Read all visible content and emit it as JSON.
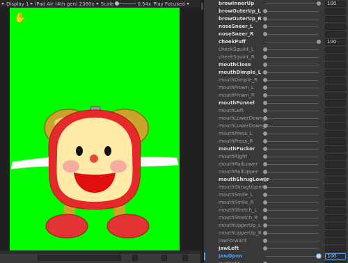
{
  "toolbar": {
    "display": "Display 1",
    "device": "iPad Air (4th gen)",
    "resolution": "2360x",
    "scale_label": "Scale",
    "scale_value": "0.54x",
    "play_mode": "Play Focused"
  },
  "colors": {
    "game_background": "#00ff00",
    "accent": "#4d9df5",
    "character_face": "#ffe9a8",
    "character_frame": "#e62a2a",
    "character_bells": "#d8b33a"
  },
  "blendshapes": [
    {
      "name": "browInnerUp",
      "value": "100",
      "level": 1.0,
      "bold": true
    },
    {
      "name": "browOuterUp_L",
      "value": "",
      "level": 0,
      "bold": true
    },
    {
      "name": "browOuterUp_R",
      "value": "",
      "level": 0,
      "bold": true
    },
    {
      "name": "noseSneer_L",
      "value": "",
      "level": 0,
      "bold": true
    },
    {
      "name": "noseSneer_R",
      "value": "",
      "level": 0,
      "bold": true
    },
    {
      "name": "cheekPuff",
      "value": "100",
      "level": 1.0,
      "bold": true
    },
    {
      "name": "cheekSquint_L",
      "value": "",
      "level": 0,
      "bold": false
    },
    {
      "name": "cheekSquint_R",
      "value": "",
      "level": 0,
      "bold": false
    },
    {
      "name": "mouthClose",
      "value": "",
      "level": 0,
      "bold": true
    },
    {
      "name": "mouthDimple_L",
      "value": "",
      "level": 0,
      "bold": true
    },
    {
      "name": "mouthDimple_R",
      "value": "",
      "level": 0,
      "bold": false
    },
    {
      "name": "mouthFrown_L",
      "value": "",
      "level": 0,
      "bold": false
    },
    {
      "name": "mouthFrown_R",
      "value": "",
      "level": 0,
      "bold": false
    },
    {
      "name": "mouthFunnel",
      "value": "",
      "level": 0,
      "bold": true
    },
    {
      "name": "mouthLeft",
      "value": "",
      "level": 0,
      "bold": false
    },
    {
      "name": "mouthLowerDown_L",
      "value": "",
      "level": 0,
      "bold": false
    },
    {
      "name": "mouthLowerDown_R",
      "value": "",
      "level": 0,
      "bold": false
    },
    {
      "name": "mouthPress_L",
      "value": "",
      "level": 0,
      "bold": false
    },
    {
      "name": "mouthPress_R",
      "value": "",
      "level": 0,
      "bold": false
    },
    {
      "name": "mouthPucker",
      "value": "",
      "level": 0,
      "bold": true
    },
    {
      "name": "mouthRight",
      "value": "",
      "level": 0,
      "bold": false
    },
    {
      "name": "mouthRollLower",
      "value": "",
      "level": 0,
      "bold": false
    },
    {
      "name": "mouthRollUpper",
      "value": "",
      "level": 0,
      "bold": false
    },
    {
      "name": "mouthShrugLower",
      "value": "",
      "level": 0,
      "bold": true
    },
    {
      "name": "mouthShrugUpper",
      "value": "",
      "level": 0,
      "bold": false
    },
    {
      "name": "mouthSmile_L",
      "value": "",
      "level": 0,
      "bold": false
    },
    {
      "name": "mouthSmile_R",
      "value": "",
      "level": 0,
      "bold": false
    },
    {
      "name": "mouthStretch_L",
      "value": "",
      "level": 0,
      "bold": false
    },
    {
      "name": "mouthStretch_R",
      "value": "",
      "level": 0,
      "bold": false
    },
    {
      "name": "mouthUpperUp_L",
      "value": "",
      "level": 0,
      "bold": false
    },
    {
      "name": "mouthUpperUp_R",
      "value": "",
      "level": 0,
      "bold": false
    },
    {
      "name": "jawForward",
      "value": "",
      "level": 0,
      "bold": false
    },
    {
      "name": "jawLeft",
      "value": "",
      "level": 0,
      "bold": true
    },
    {
      "name": "jawOpen",
      "value": "100",
      "level": 1.0,
      "bold": true,
      "active": true
    },
    {
      "name": "jawRight",
      "value": "",
      "level": 0,
      "bold": false
    }
  ]
}
